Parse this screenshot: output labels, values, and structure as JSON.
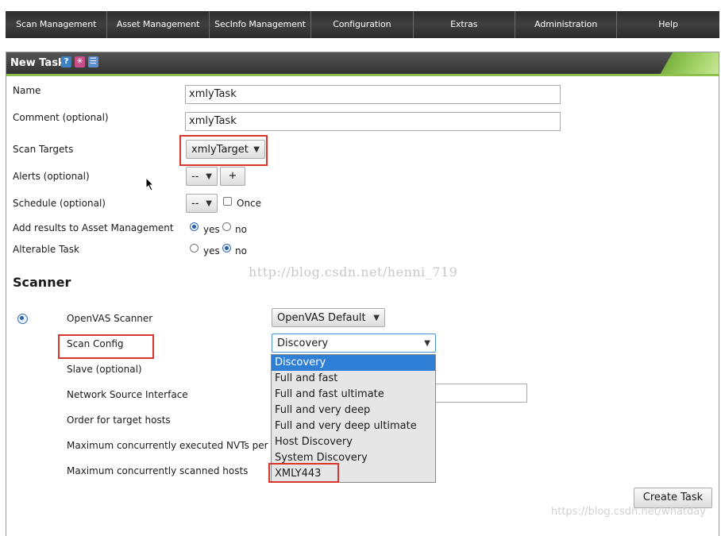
{
  "nav": [
    "Scan Management",
    "Asset Management",
    "SecInfo Management",
    "Configuration",
    "Extras",
    "Administration",
    "Help"
  ],
  "dialog": {
    "title": "New Task",
    "icons": [
      "help-icon",
      "wizard-icon",
      "list-icon"
    ]
  },
  "form": {
    "name_label": "Name",
    "name_value": "xmlyTask",
    "comment_label": "Comment (optional)",
    "comment_value": "xmlyTask",
    "targets_label": "Scan Targets",
    "targets_value": "xmlyTarget",
    "alerts_label": "Alerts (optional)",
    "alerts_value": "--",
    "alerts_add": "+",
    "schedule_label": "Schedule (optional)",
    "schedule_value": "--",
    "schedule_once": "Once",
    "asset_label": "Add results to Asset Management",
    "alterable_label": "Alterable Task",
    "yes": "yes",
    "no": "no"
  },
  "scanner": {
    "heading": "Scanner",
    "openvas_label": "OpenVAS Scanner",
    "openvas_value": "OpenVAS Default",
    "scan_config_label": "Scan Config",
    "scan_config_value": "Discovery",
    "slave_label": "Slave (optional)",
    "network_label": "Network Source Interface",
    "order_label": "Order for target hosts",
    "max_nvts_label": "Maximum concurrently executed NVTs per host",
    "max_hosts_label": "Maximum concurrently scanned hosts"
  },
  "dropdown": [
    "Discovery",
    "Full and fast",
    "Full and fast ultimate",
    "Full and very deep",
    "Full and very deep ultimate",
    "Host Discovery",
    "System Discovery",
    "XMLY443"
  ],
  "create_button": "Create Task",
  "watermark": "http://blog.csdn.net/henni_719",
  "watermark_bottom": "https://blog.csdn.net/whatday",
  "colors": {
    "accent_green": "#8fbf4d",
    "highlight_red": "#d9352f",
    "selected_blue": "#2f7fd6"
  }
}
